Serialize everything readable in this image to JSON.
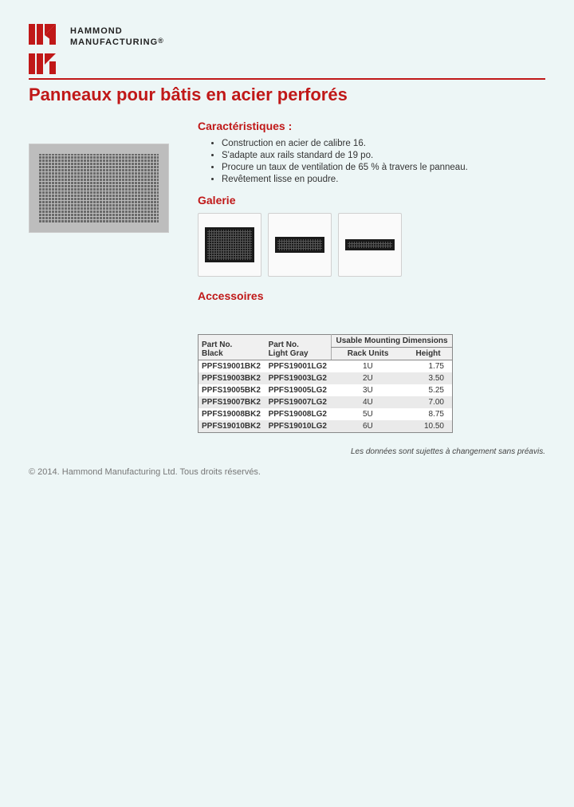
{
  "brand": {
    "line1": "HAMMOND",
    "line2": "MANUFACTURING",
    "reg": "®"
  },
  "title": "Panneaux pour bâtis en acier perforés",
  "features_heading": "Caractéristiques :",
  "features": [
    "Construction en acier de calibre 16.",
    "S'adapte aux rails standard de 19 po.",
    "Procure un taux de ventilation de 65 % à travers le panneau.",
    "Revêtement lisse en poudre."
  ],
  "gallery_heading": "Galerie",
  "accessories_heading": "Accessoires",
  "table": {
    "group_header": "Usable Mounting Dimensions",
    "col_black_l1": "Part No.",
    "col_black_l2": "Black",
    "col_gray_l1": "Part No.",
    "col_gray_l2": "Light Gray",
    "col_ru": "Rack Units",
    "col_height": "Height",
    "rows": [
      {
        "black": "PPFS19001BK2",
        "gray": "PPFS19001LG2",
        "ru": "1U",
        "height": "1.75"
      },
      {
        "black": "PPFS19003BK2",
        "gray": "PPFS19003LG2",
        "ru": "2U",
        "height": "3.50"
      },
      {
        "black": "PPFS19005BK2",
        "gray": "PPFS19005LG2",
        "ru": "3U",
        "height": "5.25"
      },
      {
        "black": "PPFS19007BK2",
        "gray": "PPFS19007LG2",
        "ru": "4U",
        "height": "7.00"
      },
      {
        "black": "PPFS19008BK2",
        "gray": "PPFS19008LG2",
        "ru": "5U",
        "height": "8.75"
      },
      {
        "black": "PPFS19010BK2",
        "gray": "PPFS19010LG2",
        "ru": "6U",
        "height": "10.50"
      }
    ]
  },
  "disclaimer": "Les données sont sujettes à changement sans préavis.",
  "copyright": "© 2014. Hammond Manufacturing Ltd. Tous droits réservés."
}
